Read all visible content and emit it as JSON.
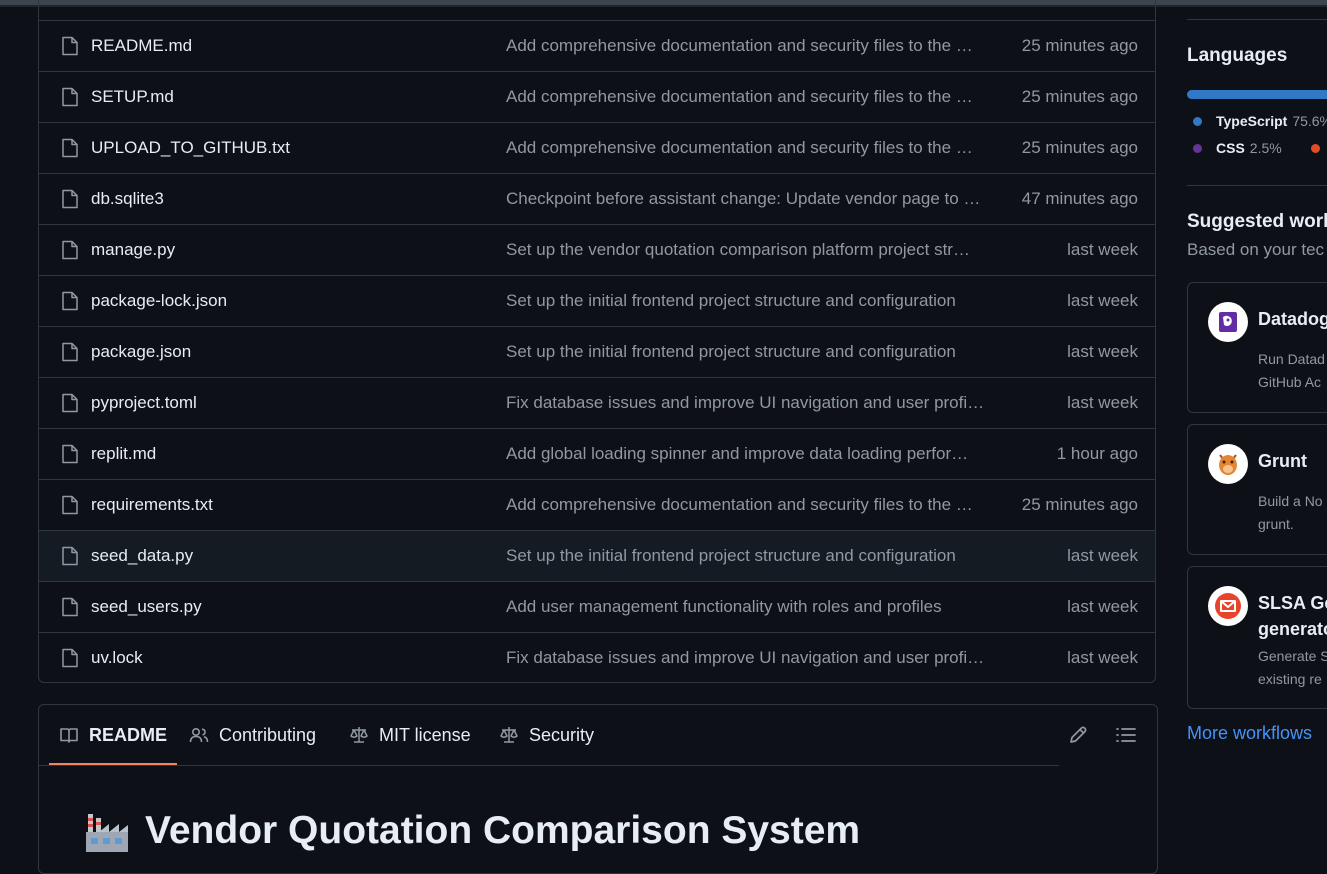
{
  "files": [
    {
      "name": "README.md",
      "message": "Add comprehensive documentation and security files to the …",
      "time": "25 minutes ago"
    },
    {
      "name": "SETUP.md",
      "message": "Add comprehensive documentation and security files to the …",
      "time": "25 minutes ago"
    },
    {
      "name": "UPLOAD_TO_GITHUB.txt",
      "message": "Add comprehensive documentation and security files to the …",
      "time": "25 minutes ago"
    },
    {
      "name": "db.sqlite3",
      "message": "Checkpoint before assistant change: Update vendor page to …",
      "time": "47 minutes ago"
    },
    {
      "name": "manage.py",
      "message": "Set up the vendor quotation comparison platform project str…",
      "time": "last week"
    },
    {
      "name": "package-lock.json",
      "message": "Set up the initial frontend project structure and configuration",
      "time": "last week"
    },
    {
      "name": "package.json",
      "message": "Set up the initial frontend project structure and configuration",
      "time": "last week"
    },
    {
      "name": "pyproject.toml",
      "message": "Fix database issues and improve UI navigation and user profi…",
      "time": "last week"
    },
    {
      "name": "replit.md",
      "message": "Add global loading spinner and improve data loading perfor…",
      "time": "1 hour ago"
    },
    {
      "name": "requirements.txt",
      "message": "Add comprehensive documentation and security files to the …",
      "time": "25 minutes ago"
    },
    {
      "name": "seed_data.py",
      "message": "Set up the initial frontend project structure and configuration",
      "time": "last week"
    },
    {
      "name": "seed_users.py",
      "message": "Add user management functionality with roles and profiles",
      "time": "last week"
    },
    {
      "name": "uv.lock",
      "message": "Fix database issues and improve UI navigation and user profi…",
      "time": "last week"
    }
  ],
  "readme": {
    "tabs": {
      "readme": "README",
      "contributing": "Contributing",
      "license": "MIT license",
      "security": "Security"
    },
    "title": "Vendor Quotation Comparison System"
  },
  "sidebar": {
    "languages_heading": "Languages",
    "languages": [
      {
        "name": "TypeScript",
        "pct": "75.6%",
        "color": "#3178c6"
      },
      {
        "name": "CSS",
        "pct": "2.5%",
        "color": "#663399"
      }
    ],
    "extra_dot_color": "#e34c26",
    "workflows_heading": "Suggested work",
    "workflows_sub": "Based on your tec",
    "workflows": [
      {
        "title": "Datadog",
        "title2": "",
        "desc1": "Run Datad",
        "desc2": "GitHub Ac"
      },
      {
        "title": "Grunt",
        "title2": "",
        "desc1": "Build a No",
        "desc2": "grunt."
      },
      {
        "title": "SLSA Ger",
        "title2": "generato",
        "desc1": "Generate S",
        "desc2": "existing re"
      }
    ],
    "more_workflows": "More workflows"
  }
}
